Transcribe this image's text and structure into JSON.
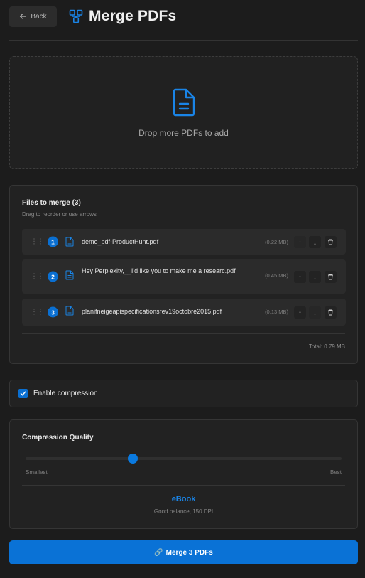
{
  "header": {
    "back_label": "Back",
    "title": "Merge PDFs"
  },
  "dropzone": {
    "text": "Drop more PDFs to add"
  },
  "files": {
    "title": "Files to merge (3)",
    "subtitle": "Drag to reorder or use arrows",
    "items": [
      {
        "index": "1",
        "name": "demo_pdf-ProductHunt.pdf",
        "size": "(0.22 MB)"
      },
      {
        "index": "2",
        "name": "Hey Perplexity,__I'd like you to make me a researc.pdf",
        "size": "(0.45 MB)"
      },
      {
        "index": "3",
        "name": "planifneigeapispecificationsrev19octobre2015.pdf",
        "size": "(0.13 MB)"
      }
    ],
    "total": "Total: 0.79 MB"
  },
  "compression": {
    "enabled": true,
    "label": "Enable compression"
  },
  "quality": {
    "title": "Compression Quality",
    "min_label": "Smallest",
    "max_label": "Best",
    "level_fraction": 0.34,
    "preset_name": "eBook",
    "preset_desc": "Good balance, 150 DPI"
  },
  "merge_button": {
    "label": "Merge 3 PDFs"
  },
  "colors": {
    "accent": "#0a72d6",
    "background": "#1c1c1c",
    "card": "#222222"
  }
}
